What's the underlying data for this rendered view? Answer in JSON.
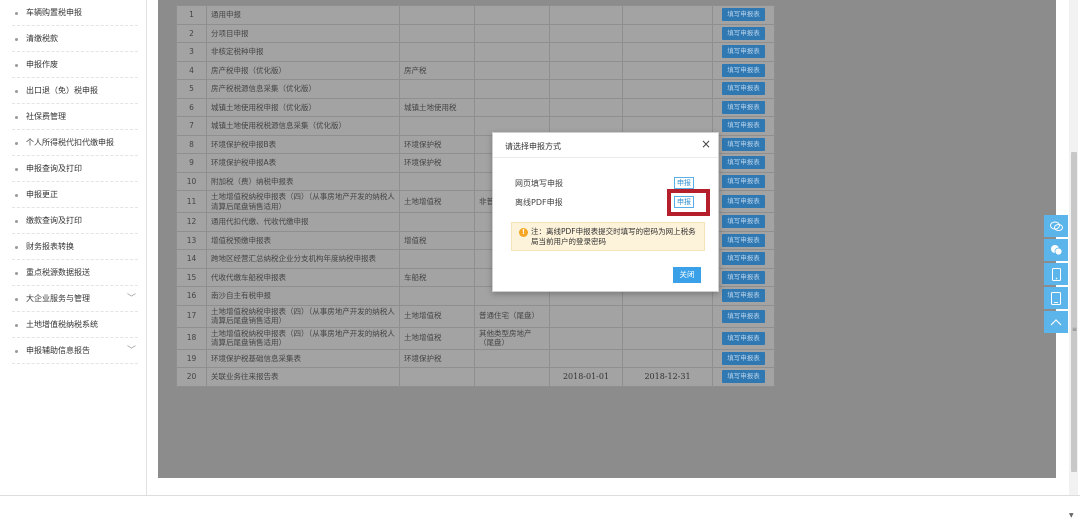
{
  "sidebar": {
    "items": [
      {
        "label": "车辆购置税申报",
        "chevron": false
      },
      {
        "label": "清缴税款",
        "chevron": false
      },
      {
        "label": "申报作废",
        "chevron": false
      },
      {
        "label": "出口退（免）税申报",
        "chevron": false
      },
      {
        "label": "社保费管理",
        "chevron": false
      },
      {
        "label": "个人所得税代扣代缴申报",
        "chevron": false
      },
      {
        "label": "申报查询及打印",
        "chevron": false
      },
      {
        "label": "申报更正",
        "chevron": false
      },
      {
        "label": "缴款查询及打印",
        "chevron": false
      },
      {
        "label": "财务报表转换",
        "chevron": false
      },
      {
        "label": "重点税源数据报送",
        "chevron": false
      },
      {
        "label": "大企业服务与管理",
        "chevron": true
      },
      {
        "label": "土地增值税纳税系统",
        "chevron": false
      },
      {
        "label": "申报辅助信息报告",
        "chevron": true
      }
    ]
  },
  "table": {
    "button_label": "填写申报表",
    "rows": [
      {
        "no": "1",
        "name": "通用申报",
        "tax": "",
        "sub": "",
        "start": "",
        "end": ""
      },
      {
        "no": "2",
        "name": "分项目申报",
        "tax": "",
        "sub": "",
        "start": "",
        "end": ""
      },
      {
        "no": "3",
        "name": "非核定税种申报",
        "tax": "",
        "sub": "",
        "start": "",
        "end": ""
      },
      {
        "no": "4",
        "name": "房产税申报（优化版）",
        "tax": "房产税",
        "sub": "",
        "start": "",
        "end": ""
      },
      {
        "no": "5",
        "name": "房产税税源信息采集（优化版）",
        "tax": "",
        "sub": "",
        "start": "",
        "end": ""
      },
      {
        "no": "6",
        "name": "城镇土地使用税申报（优化版）",
        "tax": "城镇土地使用税",
        "sub": "",
        "start": "",
        "end": ""
      },
      {
        "no": "7",
        "name": "城镇土地使用税税源信息采集（优化版）",
        "tax": "",
        "sub": "",
        "start": "",
        "end": ""
      },
      {
        "no": "8",
        "name": "环境保护税申报B表",
        "tax": "环境保护税",
        "sub": "",
        "start": "",
        "end": ""
      },
      {
        "no": "9",
        "name": "环境保护税申报A表",
        "tax": "环境保护税",
        "sub": "",
        "start": "",
        "end": ""
      },
      {
        "no": "10",
        "name": "附加税（费）纳税申报表",
        "tax": "",
        "sub": "",
        "start": "",
        "end": ""
      },
      {
        "no": "11",
        "name": "土地增值税纳税申报表（四）（从事房地产开发的纳税人清算后尾盘销售适用）",
        "tax": "土地增值税",
        "sub": "非普盘）",
        "start": "",
        "end": ""
      },
      {
        "no": "12",
        "name": "通用代扣代缴、代收代缴申报",
        "tax": "",
        "sub": "",
        "start": "",
        "end": ""
      },
      {
        "no": "13",
        "name": "增值税预缴申报表",
        "tax": "增值税",
        "sub": "",
        "start": "",
        "end": ""
      },
      {
        "no": "14",
        "name": "跨地区经营汇总纳税企业分支机构年度纳税申报表",
        "tax": "",
        "sub": "",
        "start": "",
        "end": ""
      },
      {
        "no": "15",
        "name": "代收代缴车船税申报表",
        "tax": "车船税",
        "sub": "",
        "start": "",
        "end": ""
      },
      {
        "no": "16",
        "name": "南沙自主有税申报",
        "tax": "",
        "sub": "",
        "start": "",
        "end": ""
      },
      {
        "no": "17",
        "name": "土地增值税纳税申报表（四）（从事房地产开发的纳税人清算后尾盘销售适用）",
        "tax": "土地增值税",
        "sub": "普通住宅（尾盘）",
        "start": "",
        "end": ""
      },
      {
        "no": "18",
        "name": "土地增值税纳税申报表（四）（从事房地产开发的纳税人清算后尾盘销售适用）",
        "tax": "土地增值税",
        "sub": "其他类型房地产（尾盘）",
        "start": "",
        "end": ""
      },
      {
        "no": "19",
        "name": "环境保护税基础信息采集表",
        "tax": "环境保护税",
        "sub": "",
        "start": "",
        "end": ""
      },
      {
        "no": "20",
        "name": "关联业务往来报告表",
        "tax": "",
        "sub": "",
        "start": "2018-01-01",
        "end": "2018-12-31"
      }
    ]
  },
  "modal": {
    "title": "请选择申报方式",
    "close_icon": "×",
    "option1_label": "网页填写申报",
    "option1_button": "申报",
    "option2_label": "离线PDF申报",
    "option2_button": "申报",
    "note_icon": "!",
    "note_text": "注：离线PDF申报表提交时填写的密码为网上税务局当前用户的登录密码",
    "close_button": "关闭",
    "highlight_color": "#b51f2b"
  },
  "toolbar": {
    "icons": [
      "chat-icon",
      "wechat-icon",
      "mobile-icon",
      "tablet-icon",
      "back-to-top-icon"
    ]
  }
}
